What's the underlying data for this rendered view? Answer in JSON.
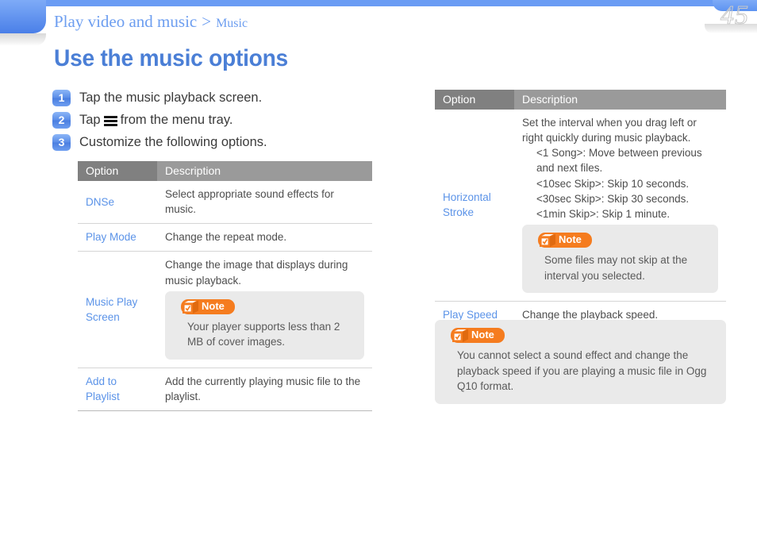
{
  "header": {
    "breadcrumb_main": "Play video and music",
    "breadcrumb_separator": ">",
    "breadcrumb_sub": "Music",
    "page_number": "45",
    "title": "Use the music options",
    "accent_blue": "#5b93e8",
    "bar_blue": "#6a9cf4",
    "note_orange": "#f57c1f"
  },
  "steps": [
    {
      "num": "1",
      "text_before": "Tap the music playback screen.",
      "icon": "",
      "text_after": ""
    },
    {
      "num": "2",
      "text_before": "Tap",
      "icon": "hamburger-menu-icon",
      "text_after": "from the menu tray."
    },
    {
      "num": "3",
      "text_before": "Customize the following options.",
      "icon": "",
      "text_after": ""
    }
  ],
  "left_table": {
    "headers": {
      "option": "Option",
      "description": "Description"
    },
    "rows": [
      {
        "option": "DNSe",
        "description": "Select appropriate sound effects for music."
      },
      {
        "option": "Play Mode",
        "description": "Change the repeat mode."
      },
      {
        "option": "Music Play\nScreen",
        "description": "Change the image that displays during music playback.",
        "note": {
          "label": "Note",
          "body": "Your player supports less than 2 MB of cover images."
        }
      },
      {
        "option": "Add to Playlist",
        "description": "Add the currently playing music file to the playlist."
      }
    ]
  },
  "right_table": {
    "headers": {
      "option": "Option",
      "description": "Description"
    },
    "rows": [
      {
        "option": "Horizontal\nStroke",
        "description": "Set the interval when you drag left or right quickly during music playback.",
        "sub_items": [
          "<1 Song>: Move between previous and next files.",
          "<10sec Skip>: Skip 10 seconds.",
          "<30sec Skip>: Skip 30 seconds.",
          "<1min Skip>: Skip 1 minute."
        ],
        "note": {
          "label": "Note",
          "body": "Some files may not skip at the interval you selected."
        }
      },
      {
        "option": "Play Speed",
        "description": "Change the playback speed."
      }
    ]
  },
  "bottom_note": {
    "label": "Note",
    "body": "You cannot select a sound effect and change the playback speed if you are playing a music file in Ogg Q10 format."
  }
}
